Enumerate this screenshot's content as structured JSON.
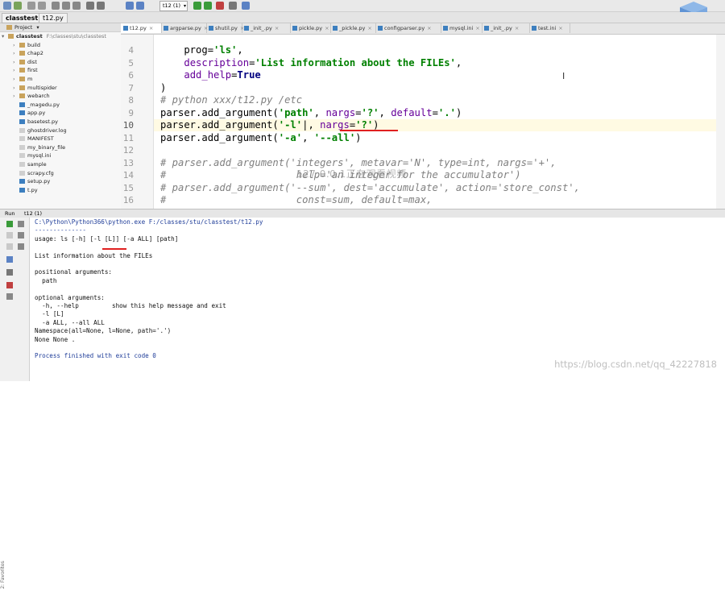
{
  "toolbar": {
    "run_config": "t12 (1)",
    "buttons": [
      "save-icon",
      "sync-icon",
      "undo-icon",
      "redo-icon",
      "cut-icon",
      "copy-icon",
      "paste-icon",
      "find-icon",
      "replace-icon",
      "back-icon",
      "forward-icon",
      "run-icon",
      "debug-icon",
      "stop-icon",
      "settings-icon",
      "help-icon"
    ]
  },
  "breadcrumb": [
    "classtest",
    "t12.py"
  ],
  "project": {
    "header": "Project",
    "root_label": "classtest",
    "root_path": "F:\\classes\\stu\\classtest",
    "items": [
      {
        "label": "build",
        "type": "folder",
        "collapsed": true
      },
      {
        "label": "chap2",
        "type": "folder",
        "collapsed": true
      },
      {
        "label": "dist",
        "type": "folder",
        "collapsed": true
      },
      {
        "label": "first",
        "type": "folder",
        "collapsed": true
      },
      {
        "label": "m",
        "type": "folder",
        "collapsed": true
      },
      {
        "label": "multispider",
        "type": "folder",
        "collapsed": true
      },
      {
        "label": "webarch",
        "type": "folder",
        "collapsed": true
      },
      {
        "label": "_magedu.py",
        "type": "py"
      },
      {
        "label": "app.py",
        "type": "py"
      },
      {
        "label": "basetest.py",
        "type": "py"
      },
      {
        "label": "ghostdriver.log",
        "type": "file"
      },
      {
        "label": "MANIFEST",
        "type": "file"
      },
      {
        "label": "my_binary_file",
        "type": "file"
      },
      {
        "label": "mysql.ini",
        "type": "file"
      },
      {
        "label": "sample",
        "type": "file"
      },
      {
        "label": "scrapy.cfg",
        "type": "file"
      },
      {
        "label": "setup.py",
        "type": "py"
      },
      {
        "label": "t.py",
        "type": "py"
      }
    ]
  },
  "tabs": [
    {
      "label": "t12.py",
      "active": true
    },
    {
      "label": "argparse.py"
    },
    {
      "label": "shutil.py"
    },
    {
      "label": "_init_.py"
    },
    {
      "label": "pickle.py"
    },
    {
      "label": "_pickle.py"
    },
    {
      "label": "configparser.py"
    },
    {
      "label": "mysql.ini"
    },
    {
      "label": "_init_.py"
    },
    {
      "label": "test.ini"
    }
  ],
  "editor": {
    "line_numbers": [
      "4",
      "5",
      "6",
      "7",
      "8",
      "9",
      "10",
      "11",
      "12",
      "13",
      "14",
      "15",
      "16"
    ],
    "current_line": "10"
  },
  "overlay_text": "127.0.0.1正在观看视频",
  "run": {
    "label": "Run",
    "config": "t12 (1)",
    "output": [
      {
        "text": "C:\\Python\\Python366\\python.exe F:/classes/stu/classtest/t12.py",
        "style": "blue"
      },
      {
        "text": "--------------",
        "style": "blue"
      },
      {
        "text": "usage: ls [-h] [-l [L]] [-a ALL] [path]",
        "style": ""
      },
      {
        "text": "",
        "style": ""
      },
      {
        "text": "List information about the FILEs",
        "style": ""
      },
      {
        "text": "",
        "style": ""
      },
      {
        "text": "positional arguments:",
        "style": ""
      },
      {
        "text": "  path",
        "style": ""
      },
      {
        "text": "",
        "style": ""
      },
      {
        "text": "optional arguments:",
        "style": ""
      },
      {
        "text": "  -h, --help         show this help message and exit",
        "style": ""
      },
      {
        "text": "  -l [L]",
        "style": ""
      },
      {
        "text": "  -a ALL, --all ALL",
        "style": ""
      },
      {
        "text": "Namespace(all=None, l=None, path='.')",
        "style": ""
      },
      {
        "text": "None None .",
        "style": ""
      },
      {
        "text": "",
        "style": ""
      },
      {
        "text": "Process finished with exit code 0",
        "style": "blue"
      }
    ]
  },
  "watermark": "https://blog.csdn.net/qq_42227818"
}
